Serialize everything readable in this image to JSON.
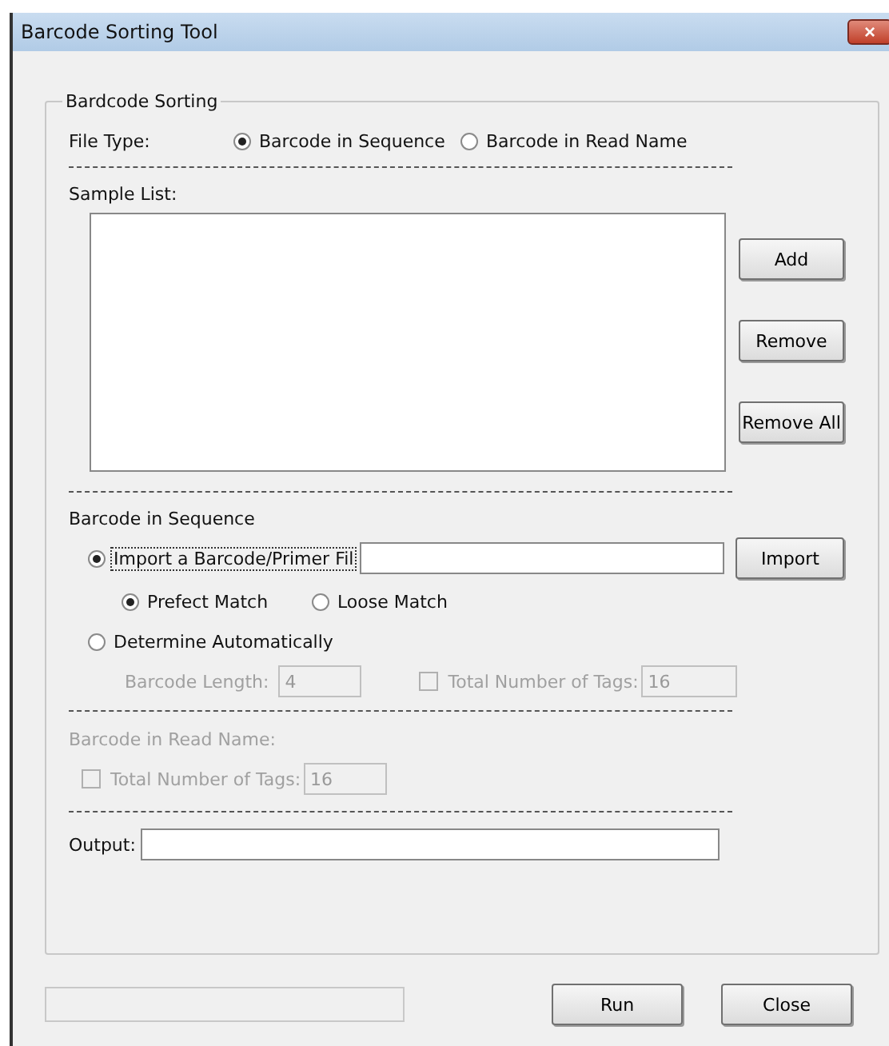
{
  "window": {
    "title": "Barcode Sorting Tool",
    "close": "×"
  },
  "group": {
    "title": "Bardcode Sorting"
  },
  "file_type": {
    "label": "File Type:",
    "options": [
      {
        "label": "Barcode in Sequence",
        "selected": true
      },
      {
        "label": "Barcode in Read Name",
        "selected": false
      }
    ]
  },
  "sample_list": {
    "label": "Sample List:",
    "buttons": [
      "Add",
      "Remove",
      "Remove All"
    ]
  },
  "barcode_in_sequence": {
    "heading": "Barcode in Sequence",
    "import_option": {
      "label": "Import a Barcode/Primer Fil",
      "selected": true,
      "focused": true
    },
    "import_button": "Import",
    "match_options": [
      {
        "label": "Prefect Match",
        "selected": true
      },
      {
        "label": "Loose Match",
        "selected": false
      }
    ],
    "determine_option": {
      "label": "Determine Automatically",
      "selected": false
    },
    "barcode_length": {
      "label": "Barcode Length:",
      "value": "4",
      "disabled": true
    },
    "total_tags": {
      "label": "Total Number of Tags:",
      "value": "16",
      "checked": false,
      "disabled": true
    }
  },
  "barcode_in_read_name": {
    "heading": "Barcode in Read Name:",
    "disabled": true,
    "total_tags": {
      "label": "Total Number of Tags:",
      "value": "16",
      "checked": false
    }
  },
  "output": {
    "label": "Output:"
  },
  "buttons": [
    "Run",
    "Close"
  ]
}
